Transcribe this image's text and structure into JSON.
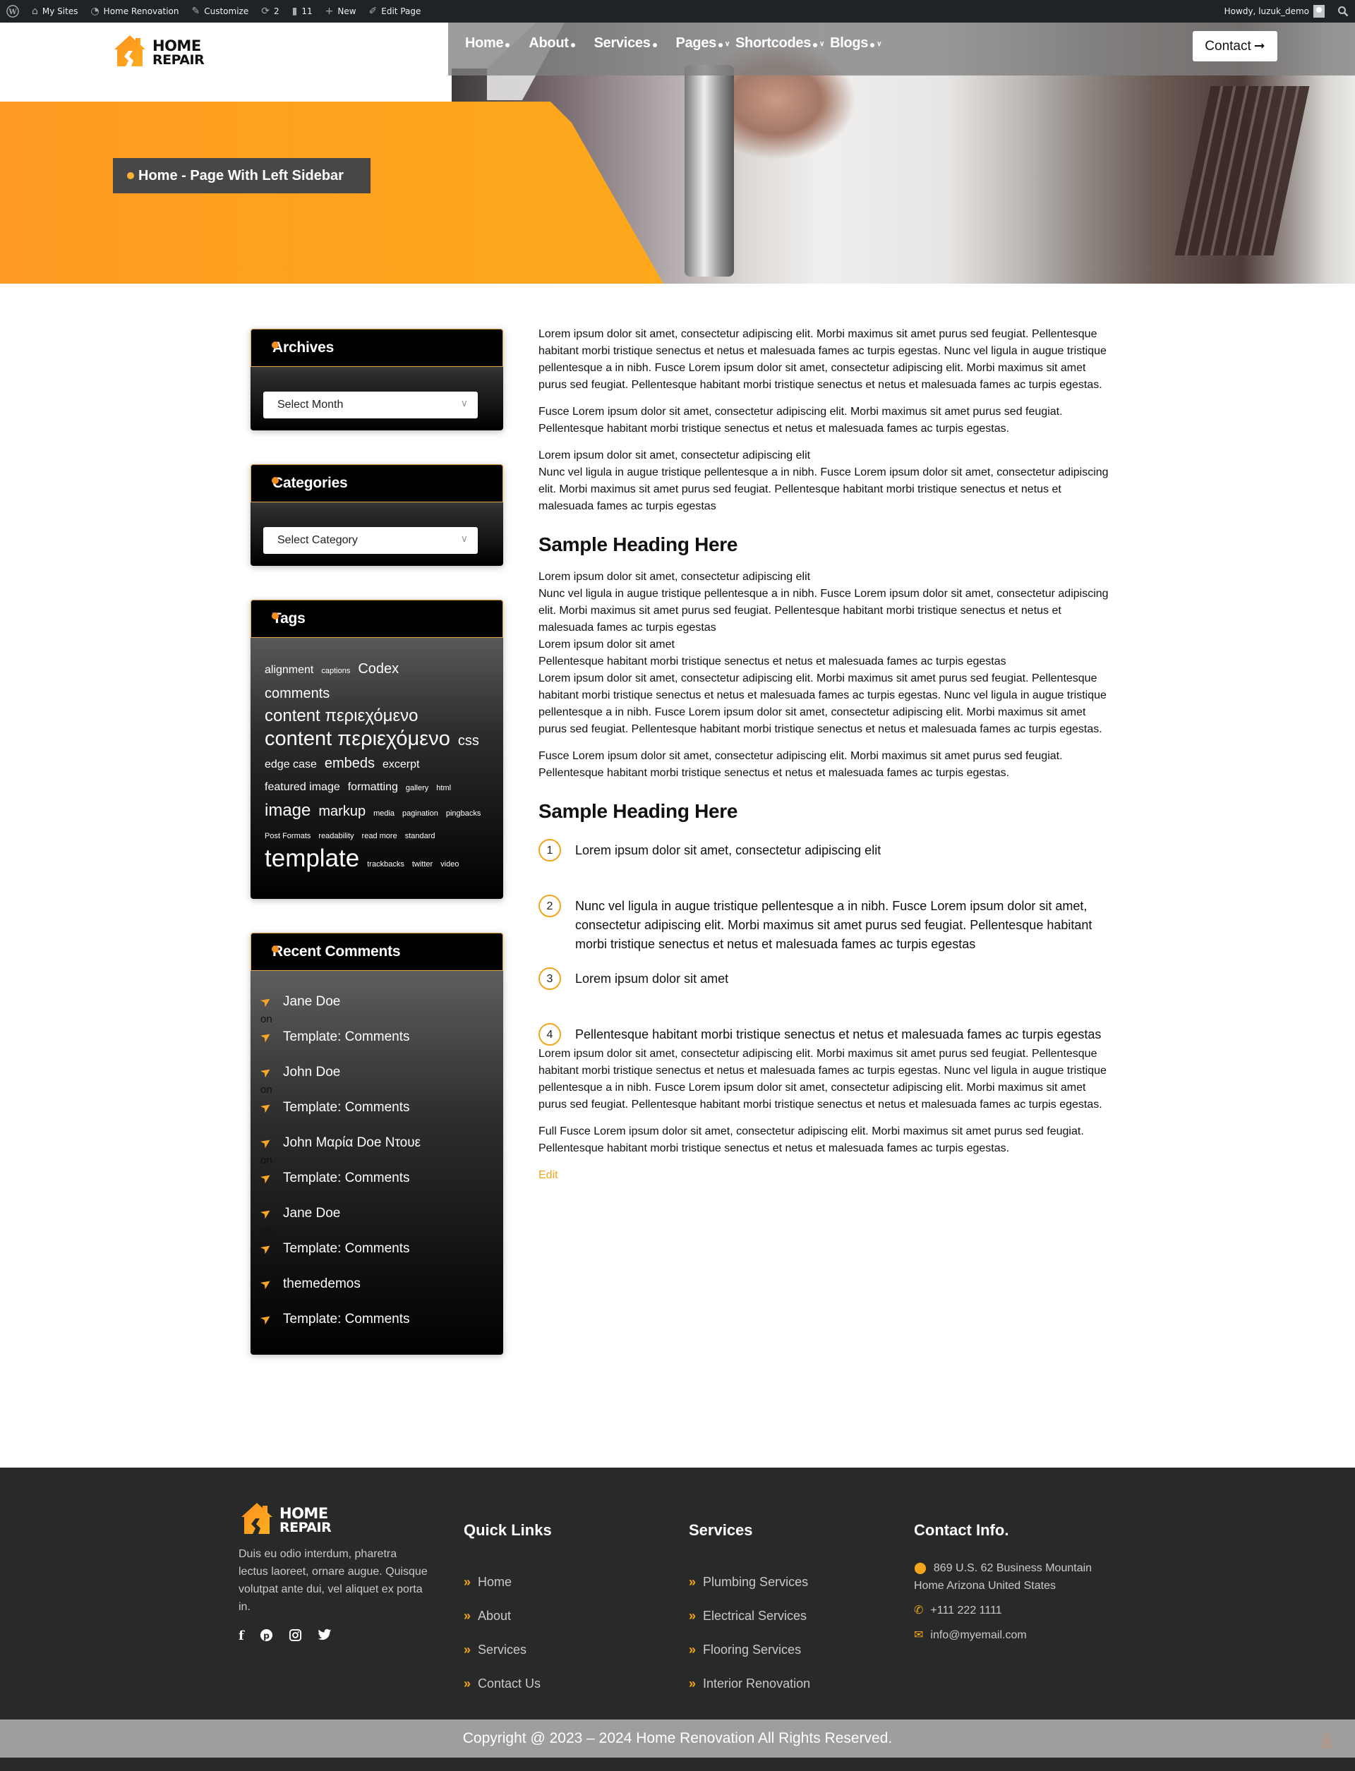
{
  "admin_bar": {
    "items": [
      {
        "icon": "wordpress-icon",
        "label": ""
      },
      {
        "icon": "my-sites-icon",
        "label": "My Sites"
      },
      {
        "icon": "dashboard-icon",
        "label": "Home Renovation"
      },
      {
        "icon": "brush-icon",
        "label": "Customize"
      },
      {
        "icon": "updates-icon",
        "label": "2"
      },
      {
        "icon": "comments-icon",
        "label": "11"
      },
      {
        "icon": "plus-icon",
        "label": "New"
      },
      {
        "icon": "pencil-icon",
        "label": "Edit Page"
      }
    ],
    "greeting": "Howdy, luzuk_demo"
  },
  "brand": {
    "line1": "HOME",
    "line2": "REPAIR",
    "accent": "#fca31e"
  },
  "nav": {
    "items": [
      {
        "label": "Home",
        "dropdown": false
      },
      {
        "label": "About",
        "dropdown": false
      },
      {
        "label": "Services",
        "dropdown": false
      },
      {
        "label": "Pages",
        "dropdown": true
      },
      {
        "label": "Shortcodes",
        "dropdown": true
      },
      {
        "label": "Blogs",
        "dropdown": true
      }
    ],
    "contact_label": "Contact"
  },
  "breadcrumb": "Home - Page With Left Sidebar",
  "sidebar": {
    "archives": {
      "title": "Archives",
      "select_value": "Select Month"
    },
    "categories": {
      "title": "Categories",
      "select_value": "Select Category"
    },
    "tags": {
      "title": "Tags",
      "items": [
        {
          "label": "alignment",
          "size": "m"
        },
        {
          "label": "captions",
          "size": "xs"
        },
        {
          "label": "Codex",
          "size": "l"
        },
        {
          "label": "comments",
          "size": "l"
        },
        {
          "label": "content περιεχόμενο",
          "size": "xl"
        },
        {
          "label": "content περιεχόμενο",
          "size": "xxl"
        },
        {
          "label": "css",
          "size": "l"
        },
        {
          "label": "edge case",
          "size": "m"
        },
        {
          "label": "embeds",
          "size": "l"
        },
        {
          "label": "excerpt",
          "size": "m"
        },
        {
          "label": "featured image",
          "size": "m"
        },
        {
          "label": "formatting",
          "size": "m"
        },
        {
          "label": "gallery",
          "size": "xs"
        },
        {
          "label": "html",
          "size": "xs"
        },
        {
          "label": "image",
          "size": "xl"
        },
        {
          "label": "markup",
          "size": "l"
        },
        {
          "label": "media",
          "size": "xs"
        },
        {
          "label": "pagination",
          "size": "xs"
        },
        {
          "label": "pingbacks",
          "size": "xs"
        },
        {
          "label": "Post Formats",
          "size": "xs"
        },
        {
          "label": "readability",
          "size": "xs"
        },
        {
          "label": "read more",
          "size": "xs"
        },
        {
          "label": "standard",
          "size": "xs"
        },
        {
          "label": "template",
          "size": "xxxl"
        },
        {
          "label": "trackbacks",
          "size": "xs"
        },
        {
          "label": "twitter",
          "size": "xs"
        },
        {
          "label": "video",
          "size": "xs"
        }
      ]
    },
    "recent_comments": {
      "title": "Recent Comments",
      "connector": "on",
      "items": [
        {
          "author": "Jane Doe",
          "post": "Template: Comments"
        },
        {
          "author": "John Doe",
          "post": "Template: Comments"
        },
        {
          "author": "John Μαρία Doe Ντουε",
          "post": "Template: Comments"
        },
        {
          "author": "Jane Doe",
          "post": "Template: Comments"
        },
        {
          "author": "themedemos",
          "post": "Template: Comments"
        }
      ]
    }
  },
  "content": {
    "p1": "Lorem ipsum dolor sit amet, consectetur adipiscing elit. Morbi maximus sit amet purus sed feugiat. Pellentesque habitant morbi tristique senectus et netus et malesuada fames ac turpis egestas. Nunc vel ligula in augue tristique pellentesque a in nibh. Fusce Lorem ipsum dolor sit amet, consectetur adipiscing elit. Morbi maximus sit amet purus sed feugiat. Pellentesque habitant morbi tristique senectus et netus et malesuada fames ac turpis egestas.",
    "p2": "Fusce Lorem ipsum dolor sit amet, consectetur adipiscing elit. Morbi maximus sit amet purus sed feugiat. Pellentesque habitant morbi tristique senectus et netus et malesuada fames ac turpis egestas.",
    "p3_line1": "Lorem ipsum dolor sit amet, consectetur adipiscing elit",
    "p3_line2": "Nunc vel ligula in augue tristique pellentesque a in nibh. Fusce Lorem ipsum dolor sit amet, consectetur adipiscing elit. Morbi maximus sit amet purus sed feugiat. Pellentesque habitant morbi tristique senectus et netus et malesuada fames ac turpis egestas",
    "heading1": "Sample Heading Here",
    "s1_line1": "Lorem ipsum dolor sit amet, consectetur adipiscing elit",
    "s1_line2": "Nunc vel ligula in augue tristique pellentesque a in nibh. Fusce Lorem ipsum dolor sit amet, consectetur adipiscing elit. Morbi maximus sit amet purus sed feugiat. Pellentesque habitant morbi tristique senectus et netus et malesuada fames ac turpis egestas",
    "s1_line3": "Lorem ipsum dolor sit amet",
    "s1_line4": "Pellentesque habitant morbi tristique senectus et netus et malesuada fames ac turpis egestas",
    "s1_line5": "Lorem ipsum dolor sit amet, consectetur adipiscing elit. Morbi maximus sit amet purus sed feugiat. Pellentesque habitant morbi tristique senectus et netus et malesuada fames ac turpis egestas. Nunc vel ligula in augue tristique pellentesque a in nibh. Fusce Lorem ipsum dolor sit amet, consectetur adipiscing elit. Morbi maximus sit amet purus sed feugiat. Pellentesque habitant morbi tristique senectus et netus et malesuada fames ac turpis egestas.",
    "s1_p2": "Fusce Lorem ipsum dolor sit amet, consectetur adipiscing elit. Morbi maximus sit amet purus sed feugiat. Pellentesque habitant morbi tristique senectus et netus et malesuada fames ac turpis egestas.",
    "heading2": "Sample Heading Here",
    "list": [
      {
        "num": "1",
        "text": "Lorem ipsum dolor sit amet, consectetur adipiscing elit"
      },
      {
        "num": "2",
        "text": "Nunc vel ligula in augue tristique pellentesque a in nibh. Fusce Lorem ipsum dolor sit amet, consectetur adipiscing elit. Morbi maximus sit amet purus sed feugiat. Pellentesque habitant morbi tristique senectus et netus et malesuada fames ac turpis egestas"
      },
      {
        "num": "3",
        "text": "Lorem ipsum dolor sit amet"
      },
      {
        "num": "4",
        "text": "Pellentesque habitant morbi tristique senectus et netus et malesuada fames ac turpis egestas"
      }
    ],
    "s2_p1": "Lorem ipsum dolor sit amet, consectetur adipiscing elit. Morbi maximus sit amet purus sed feugiat. Pellentesque habitant morbi tristique senectus et netus et malesuada fames ac turpis egestas. Nunc vel ligula in augue tristique pellentesque a in nibh. Fusce Lorem ipsum dolor sit amet, consectetur adipiscing elit. Morbi maximus sit amet purus sed feugiat. Pellentesque habitant morbi tristique senectus et netus et malesuada fames ac turpis egestas.",
    "s2_p2": "Full Fusce Lorem ipsum dolor sit amet, consectetur adipiscing elit. Morbi maximus sit amet purus sed feugiat. Pellentesque habitant morbi tristique senectus et netus et malesuada fames ac turpis egestas.",
    "edit_label": "Edit"
  },
  "footer": {
    "about": "Duis eu odio interdum, pharetra lectus laoreet, ornare augue. Quisque volutpat ante dui, vel aliquet ex porta in.",
    "social": [
      "facebook-icon",
      "pinterest-icon",
      "instagram-icon",
      "twitter-icon"
    ],
    "quick_links": {
      "title": "Quick Links",
      "items": [
        "Home",
        "About",
        "Services",
        "Contact Us"
      ]
    },
    "services": {
      "title": "Services",
      "items": [
        "Plumbing Services",
        "Electrical Services",
        "Flooring Services",
        "Interior Renovation"
      ]
    },
    "contact": {
      "title": "Contact Info.",
      "address": "869 U.S. 62 Business Mountain Home Arizona United States",
      "phone": "+111 222 1111",
      "email": "info@myemail.com"
    },
    "copyright": "Copyright @ 2023 – 2024 Home Renovation All Rights Reserved."
  }
}
